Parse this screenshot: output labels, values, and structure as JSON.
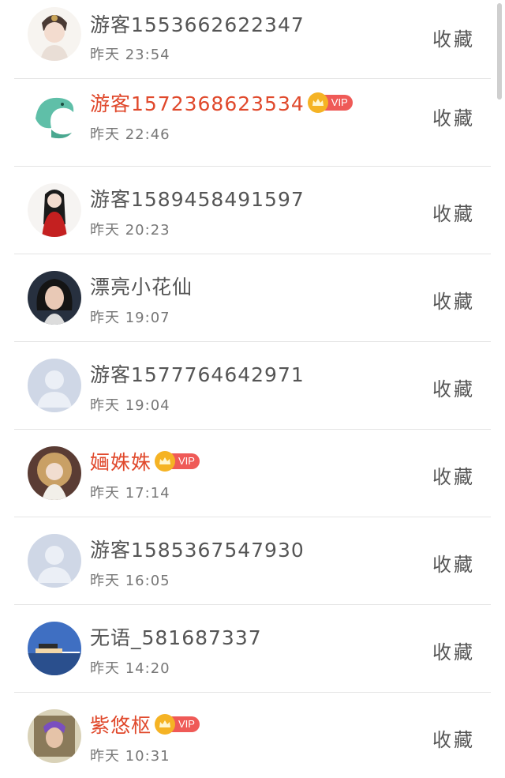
{
  "fav_label": "收藏",
  "vip_label": "VIP",
  "colors": {
    "vip_name": "#e0492c",
    "normal_name": "#555555",
    "vip_badge": "#ef5a57",
    "crown": "#f5b324"
  },
  "items": [
    {
      "name": "游客1553662622347",
      "time": "昨天 23:54",
      "vip": false,
      "avatar": "woman-headdress-avatar"
    },
    {
      "name": "游客1572368623534",
      "time": "昨天 22:46",
      "vip": true,
      "avatar": "dolphin-avatar"
    },
    {
      "name": "游客1589458491597",
      "time": "昨天 20:23",
      "vip": false,
      "avatar": "red-dress-girl-avatar"
    },
    {
      "name": "漂亮小花仙",
      "time": "昨天 19:07",
      "vip": false,
      "avatar": "woman-portrait-avatar"
    },
    {
      "name": "游客1577764642971",
      "time": "昨天 19:04",
      "vip": false,
      "avatar": "default-user-avatar"
    },
    {
      "name": "婳姝姝",
      "time": "昨天 17:14",
      "vip": true,
      "avatar": "ornate-girl-avatar"
    },
    {
      "name": "游客1585367547930",
      "time": "昨天 16:05",
      "vip": false,
      "avatar": "default-user-avatar"
    },
    {
      "name": "无语_581687337",
      "time": "昨天 14:20",
      "vip": false,
      "avatar": "seaside-pier-avatar"
    },
    {
      "name": "紫悠枢",
      "time": "昨天 10:31",
      "vip": true,
      "avatar": "man-portrait-avatar"
    }
  ]
}
